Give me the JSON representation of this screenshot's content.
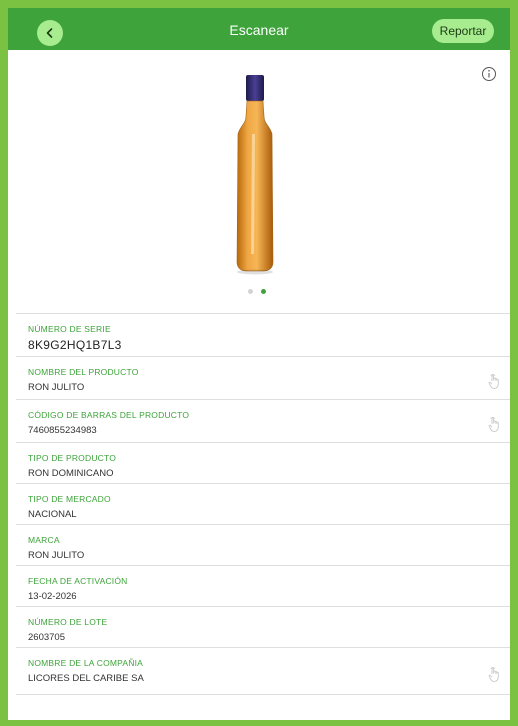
{
  "header": {
    "title": "Escanear",
    "report_label": "Reportar"
  },
  "image_carousel": {
    "image_description": "bottle-of-rum",
    "page_count": 2,
    "active_page": 2
  },
  "fields": [
    {
      "label": "NÚMERO DE SERIE",
      "value": "8K9G2HQ1B7L3",
      "tap_icon": false
    },
    {
      "label": "NOMBRE DEL PRODUCTO",
      "value": "RON JULITO",
      "tap_icon": true
    },
    {
      "label": "CÓDIGO DE BARRAS DEL PRODUCTO",
      "value": "7460855234983",
      "tap_icon": true
    },
    {
      "label": "TIPO DE PRODUCTO",
      "value": "RON DOMINICANO",
      "tap_icon": false
    },
    {
      "label": "TIPO DE MERCADO",
      "value": "NACIONAL",
      "tap_icon": false
    },
    {
      "label": "MARCA",
      "value": "RON JULITO",
      "tap_icon": false
    },
    {
      "label": "FECHA DE ACTIVACIÓN",
      "value": "13-02-2026",
      "tap_icon": false
    },
    {
      "label": "NÚMERO DE LOTE",
      "value": "2603705",
      "tap_icon": false
    },
    {
      "label": "NOMBRE DE LA COMPAÑIA",
      "value": "LICORES DEL CARIBE SA",
      "tap_icon": true
    }
  ],
  "colors": {
    "brand_green": "#3da33a",
    "light_green": "#a7ec8f",
    "frame_green": "#7cc242"
  }
}
